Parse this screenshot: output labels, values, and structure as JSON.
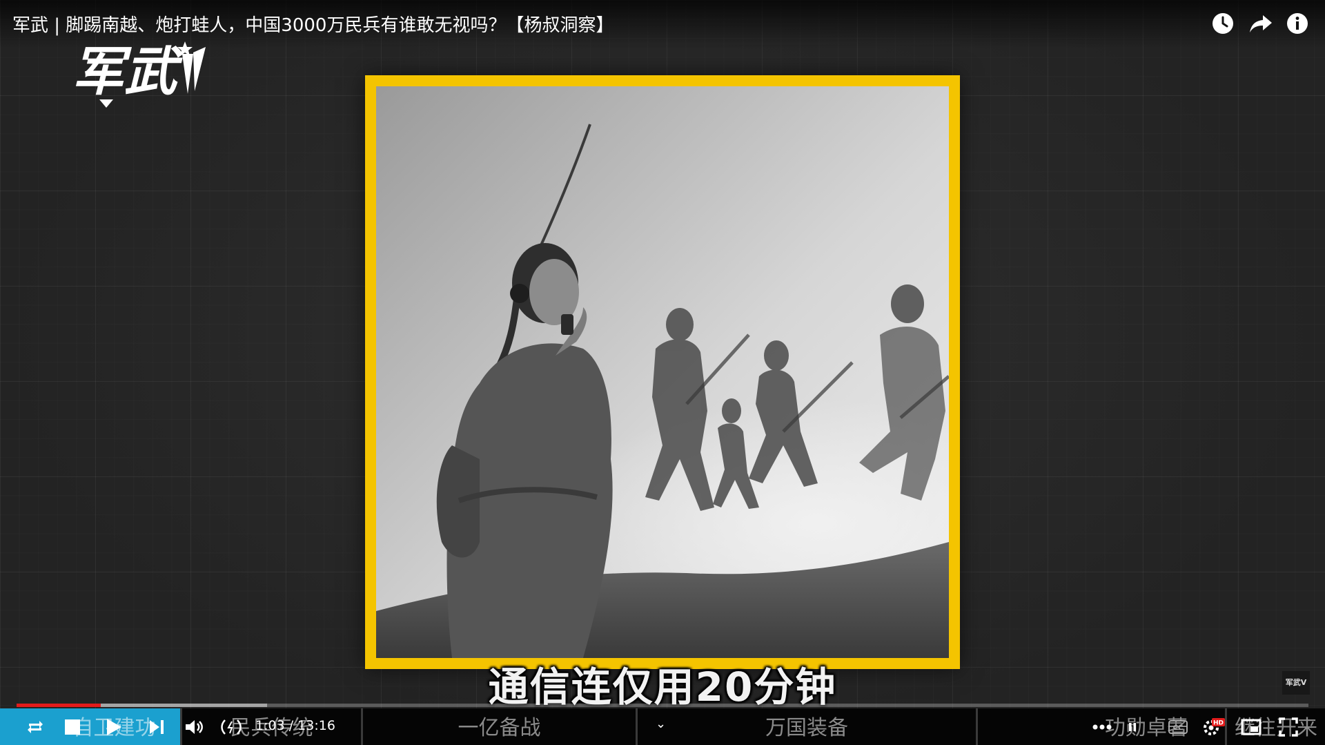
{
  "video": {
    "title": "军武 | 脚踢南越、炮打蛙人，中国3000万民兵有谁敢无视吗？【杨叔洞察】",
    "subtitle": "通信连仅用20分钟",
    "watermark": "军武V"
  },
  "logo": {
    "text": "军武"
  },
  "top_actions": [
    {
      "name": "watch-later-icon"
    },
    {
      "name": "share-icon"
    },
    {
      "name": "info-icon"
    }
  ],
  "player": {
    "current_time": "1:03",
    "duration": "13:16",
    "time_display": "1:03 / 13:16",
    "progress_played_fraction": 0.065,
    "progress_loaded_fraction": 0.194,
    "colors": {
      "progress": "#e21b1b",
      "frame": "#f4c400",
      "chapter_active": "#1ba0cf"
    }
  },
  "chapters": [
    {
      "label": "自卫建功"
    },
    {
      "label": "民兵传统"
    },
    {
      "label": "一亿备战"
    },
    {
      "label": "万国装备"
    },
    {
      "label": "功勋卓著"
    },
    {
      "label": "继往开来"
    }
  ],
  "controls": {
    "loop": "loop-icon",
    "stop": "stop-icon",
    "play": "play-icon",
    "next": "next-icon",
    "volume": "volume-icon",
    "radio": "radio-icon",
    "more": "more-icon",
    "pause_small": "pause-icon",
    "captions": "captions-icon",
    "captions_label": "CC",
    "settings": "settings-icon",
    "hd_badge": "HD",
    "miniplayer": "miniplayer-icon",
    "fullscreen": "fullscreen-icon"
  }
}
